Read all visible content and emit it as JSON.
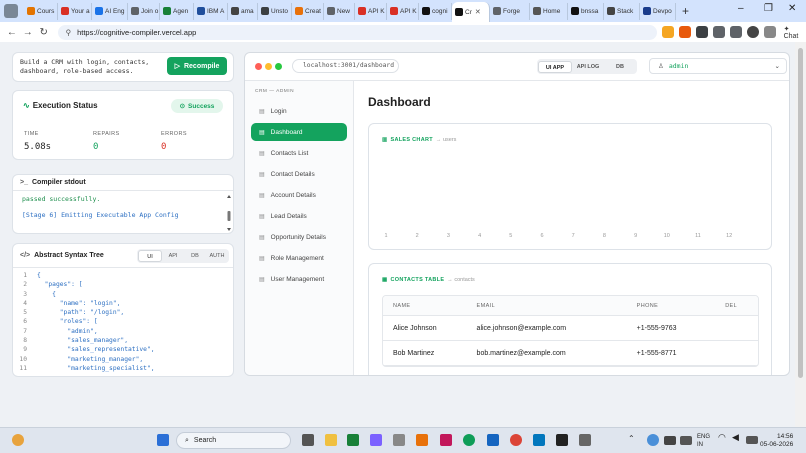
{
  "browser": {
    "tabs": [
      {
        "label": "Cours",
        "color": "#e37400"
      },
      {
        "label": "Your a",
        "color": "#d93025"
      },
      {
        "label": "AI Eng",
        "color": "#1a73e8"
      },
      {
        "label": "Join o",
        "color": "#5f6368"
      },
      {
        "label": "Agen",
        "color": "#188038"
      },
      {
        "label": "IBM A",
        "color": "#1f4e9c"
      },
      {
        "label": "ama",
        "color": "#444"
      },
      {
        "label": "Unsto",
        "color": "#3c4043"
      },
      {
        "label": "Creat",
        "color": "#e8710a"
      },
      {
        "label": "New",
        "color": "#5f6368"
      },
      {
        "label": "API K",
        "color": "#d93025"
      },
      {
        "label": "API K",
        "color": "#d93025"
      },
      {
        "label": "cogni",
        "color": "#111"
      },
      {
        "label": "Cr",
        "color": "#111",
        "active": true
      },
      {
        "label": "Forge",
        "color": "#5f6368"
      },
      {
        "label": "Home",
        "color": "#555"
      },
      {
        "label": "bnssa",
        "color": "#111"
      },
      {
        "label": "Stack",
        "color": "#444"
      },
      {
        "label": "Devpo",
        "color": "#1a3c8c"
      }
    ],
    "url": "https://cognitive-compiler.vercel.app",
    "chat_label": "Chat"
  },
  "prompt": {
    "text": "Build a CRM with login, contacts, dashboard, role-based access.",
    "recompile_label": "Recompile"
  },
  "execution": {
    "title": "Execution Status",
    "status": "Success",
    "time_label": "TIME",
    "time_value": "5.08s",
    "repairs_label": "REPAIRS",
    "repairs_value": "0",
    "errors_label": "ERRORS",
    "errors_value": "0"
  },
  "stdout": {
    "title": "Compiler stdout",
    "line1": "passed successfully.",
    "line2": "[Stage 6] Emitting Executable App Config"
  },
  "ast": {
    "title": "Abstract Syntax Tree",
    "tabs": [
      "UI",
      "API",
      "DB",
      "AUTH"
    ],
    "active_tab": "UI",
    "lines": [
      {
        "n": "1",
        "t": "{"
      },
      {
        "n": "2",
        "t": "  \"pages\": ["
      },
      {
        "n": "3",
        "t": "    {"
      },
      {
        "n": "4",
        "t": "      \"name\": \"login\","
      },
      {
        "n": "5",
        "t": "      \"path\": \"/login\","
      },
      {
        "n": "6",
        "t": "      \"roles\": ["
      },
      {
        "n": "7",
        "t": "        \"admin\","
      },
      {
        "n": "8",
        "t": "        \"sales_manager\","
      },
      {
        "n": "9",
        "t": "        \"sales_representative\","
      },
      {
        "n": "10",
        "t": "        \"marketing_manager\","
      },
      {
        "n": "11",
        "t": "        \"marketing_specialist\","
      }
    ]
  },
  "app": {
    "url": "localhost:3001/dashboard",
    "modes": [
      "UI APP",
      "API LOG",
      "DB"
    ],
    "active_mode": "UI APP",
    "user": "admin",
    "crm_label": "CRM — ADMIN",
    "nav": [
      {
        "label": "Login"
      },
      {
        "label": "Dashboard",
        "active": true
      },
      {
        "label": "Contacts List"
      },
      {
        "label": "Contact Details"
      },
      {
        "label": "Account Details"
      },
      {
        "label": "Lead Details"
      },
      {
        "label": "Opportunity Details"
      },
      {
        "label": "Role Management"
      },
      {
        "label": "User Management"
      }
    ],
    "page_title": "Dashboard",
    "sales_chart": {
      "title": "SALES CHART",
      "sub": "→ users"
    },
    "contacts_table": {
      "title": "CONTACTS TABLE",
      "sub": "→ contacts",
      "columns": [
        "NAME",
        "EMAIL",
        "PHONE",
        "DEL"
      ],
      "rows": [
        {
          "name": "Alice Johnson",
          "email": "alice.johnson@example.com",
          "phone": "+1-555-9763"
        },
        {
          "name": "Bob Martinez",
          "email": "bob.martinez@example.com",
          "phone": "+1-555-8771"
        }
      ]
    }
  },
  "chart_data": {
    "type": "bar",
    "categories": [
      "1",
      "2",
      "3",
      "4",
      "5",
      "6",
      "7",
      "8",
      "9",
      "10",
      "11",
      "12"
    ],
    "values": [
      0,
      0,
      0,
      0,
      0,
      0,
      0,
      0,
      0,
      0,
      0,
      0
    ],
    "title": "SALES CHART",
    "xlabel": "",
    "ylabel": "",
    "grid": false
  },
  "taskbar": {
    "search_label": "Search",
    "lang": "ENG",
    "region": "IN",
    "time": "14:56",
    "date": "05-06-2026"
  }
}
